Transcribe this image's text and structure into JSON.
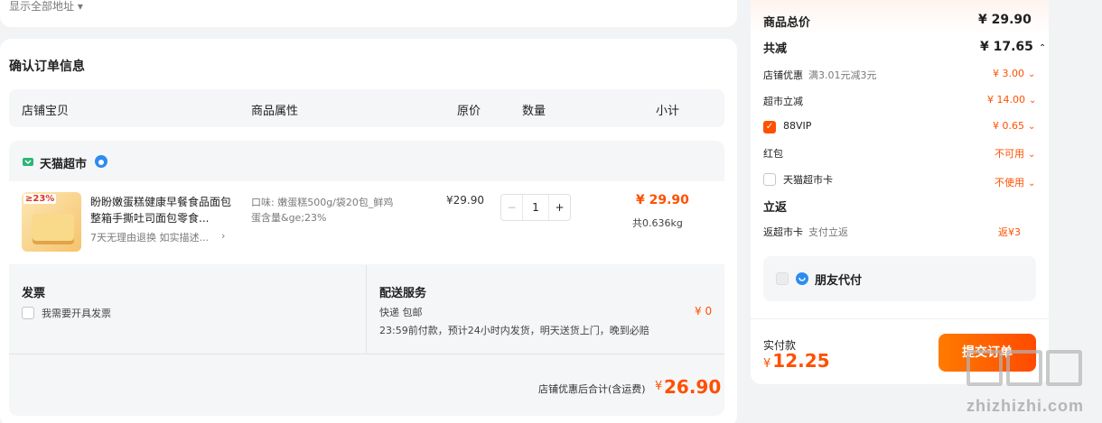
{
  "address": {
    "show_all": "显示全部地址"
  },
  "order": {
    "title": "确认订单信息",
    "headers": {
      "shop": "店铺宝贝",
      "attr": "商品属性",
      "price": "原价",
      "qty": "数量",
      "subtotal": "小计"
    },
    "store": {
      "name": "天猫超市"
    },
    "product": {
      "badge": "≥23%",
      "name": "盼盼嫩蛋糕健康早餐食品面包整箱手撕吐司面包零食...",
      "tags": "7天无理由退换  如实描述...",
      "attr": "口味: 嫩蛋糕500g/袋20包_鲜鸡蛋含量&ge;23%",
      "price": "¥29.90",
      "qty": "1",
      "subtotal": "¥ 29.90",
      "weight": "共0.636kg"
    },
    "invoice": {
      "title": "发票",
      "option": "我需要开具发票"
    },
    "delivery": {
      "title": "配送服务",
      "method": "快递 包邮",
      "desc": "23:59前付款，预计24小时内发货，明天送货上门，晚到必赔",
      "fee": "¥ 0"
    },
    "total": {
      "label": "店铺优惠后合计(含运费)",
      "currency": "¥",
      "amount": "26.90"
    }
  },
  "summary": {
    "goods_total_label": "商品总价",
    "goods_total": "¥ 29.90",
    "discount_label": "共减",
    "discount_total": "¥ 17.65",
    "rows": [
      {
        "label": "店铺优惠",
        "sub": "满3.01元减3元",
        "value": "¥ 3.00"
      },
      {
        "label": "超市立减",
        "sub": "",
        "value": "¥ 14.00"
      },
      {
        "label": "88VIP",
        "sub": "",
        "value": "¥ 0.65"
      },
      {
        "label": "红包",
        "sub": "",
        "value": "不可用"
      },
      {
        "label": "天猫超市卡",
        "sub": "",
        "value": "不使用"
      }
    ],
    "rebate_title": "立返",
    "rebate_label": "返超市卡",
    "rebate_sub": "支付立返",
    "rebate_value": "返¥3",
    "friend_pay": "朋友代付",
    "actual_label": "实付款",
    "actual_currency": "¥",
    "actual_amount": "12.25",
    "submit": "提交订单"
  },
  "watermark": {
    "text": "zhizhizhi.com"
  },
  "colors": {
    "accent": "#ff5000",
    "page_bg": "#f2f3f5"
  }
}
